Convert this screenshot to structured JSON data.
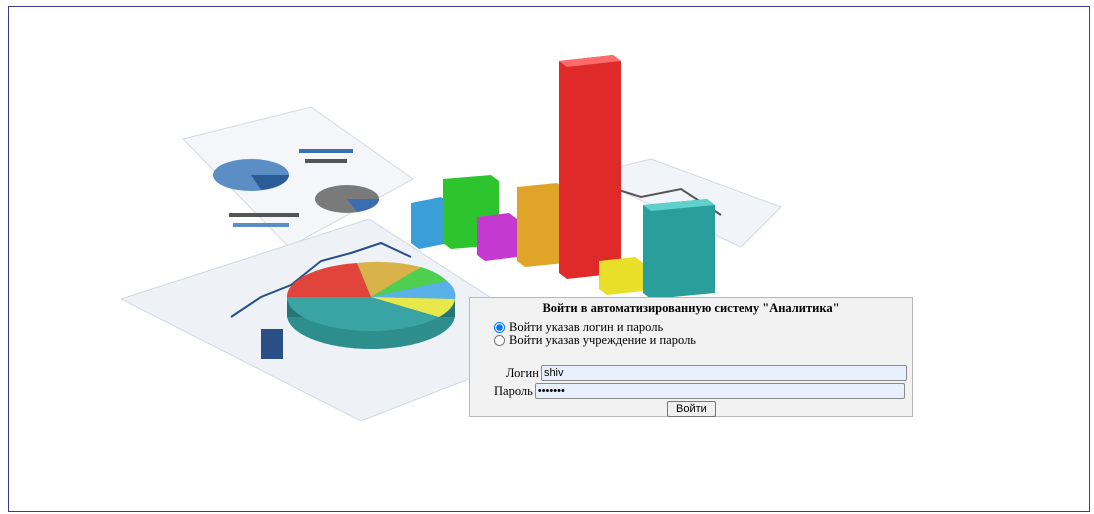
{
  "login": {
    "title": "Войти в автоматизированную систему \"Аналитика\"",
    "mode_options": [
      {
        "label": "Войти указав логин и пароль",
        "selected": true
      },
      {
        "label": "Войти указав учреждение и пароль",
        "selected": false
      }
    ],
    "login_label": "Логин",
    "login_value": "shiv",
    "password_label": "Пароль",
    "password_value": "1234567",
    "submit_label": "Войти"
  },
  "colors": {
    "frame_border": "#3c3c8c",
    "form_background": "#f2f2f2",
    "input_fill": "#e8f0fe"
  }
}
